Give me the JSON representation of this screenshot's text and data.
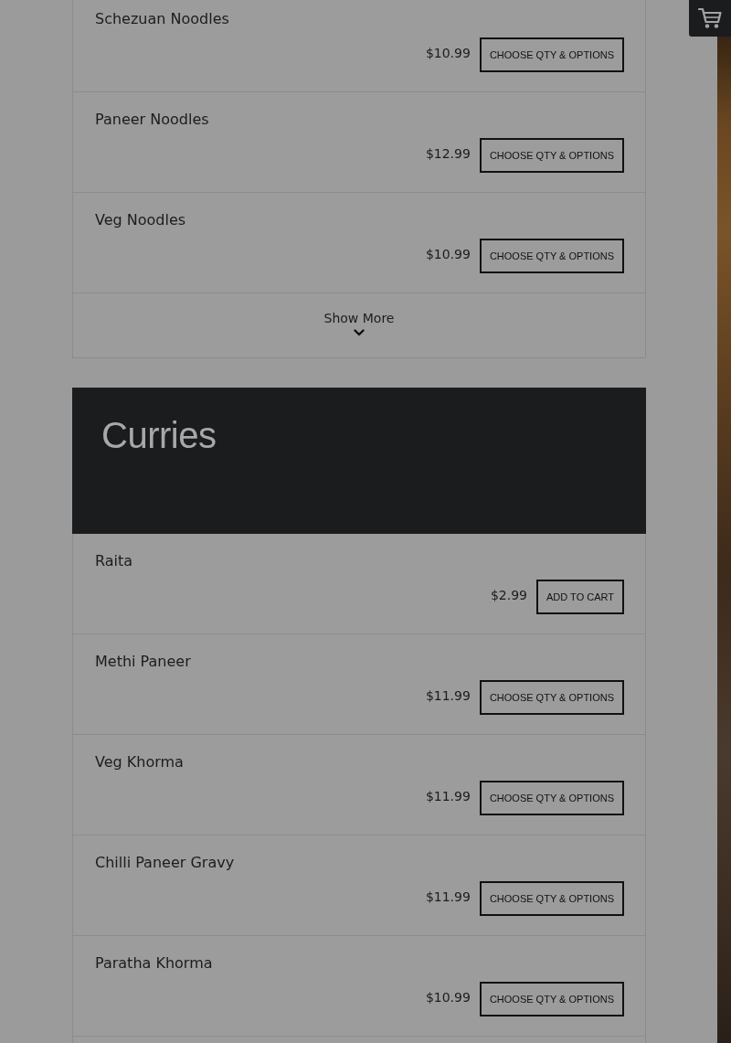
{
  "sections": [
    {
      "items": [
        {
          "name": "Schezuan Noodles",
          "price": "$10.99",
          "button": "CHOOSE QTY & OPTIONS"
        },
        {
          "name": "Paneer Noodles",
          "price": "$12.99",
          "button": "CHOOSE QTY & OPTIONS"
        },
        {
          "name": "Veg Noodles",
          "price": "$10.99",
          "button": "CHOOSE QTY & OPTIONS"
        }
      ],
      "show_more": "Show More"
    },
    {
      "title": "Curries",
      "items": [
        {
          "name": "Raita",
          "price": "$2.99",
          "button": "ADD TO CART"
        },
        {
          "name": "Methi Paneer",
          "price": "$11.99",
          "button": "CHOOSE QTY & OPTIONS"
        },
        {
          "name": "Veg Khorma",
          "price": "$11.99",
          "button": "CHOOSE QTY & OPTIONS"
        },
        {
          "name": "Chilli Paneer Gravy",
          "price": "$11.99",
          "button": "CHOOSE QTY & OPTIONS"
        },
        {
          "name": "Paratha Khorma",
          "price": "$10.99",
          "button": "CHOOSE QTY & OPTIONS"
        }
      ]
    }
  ]
}
